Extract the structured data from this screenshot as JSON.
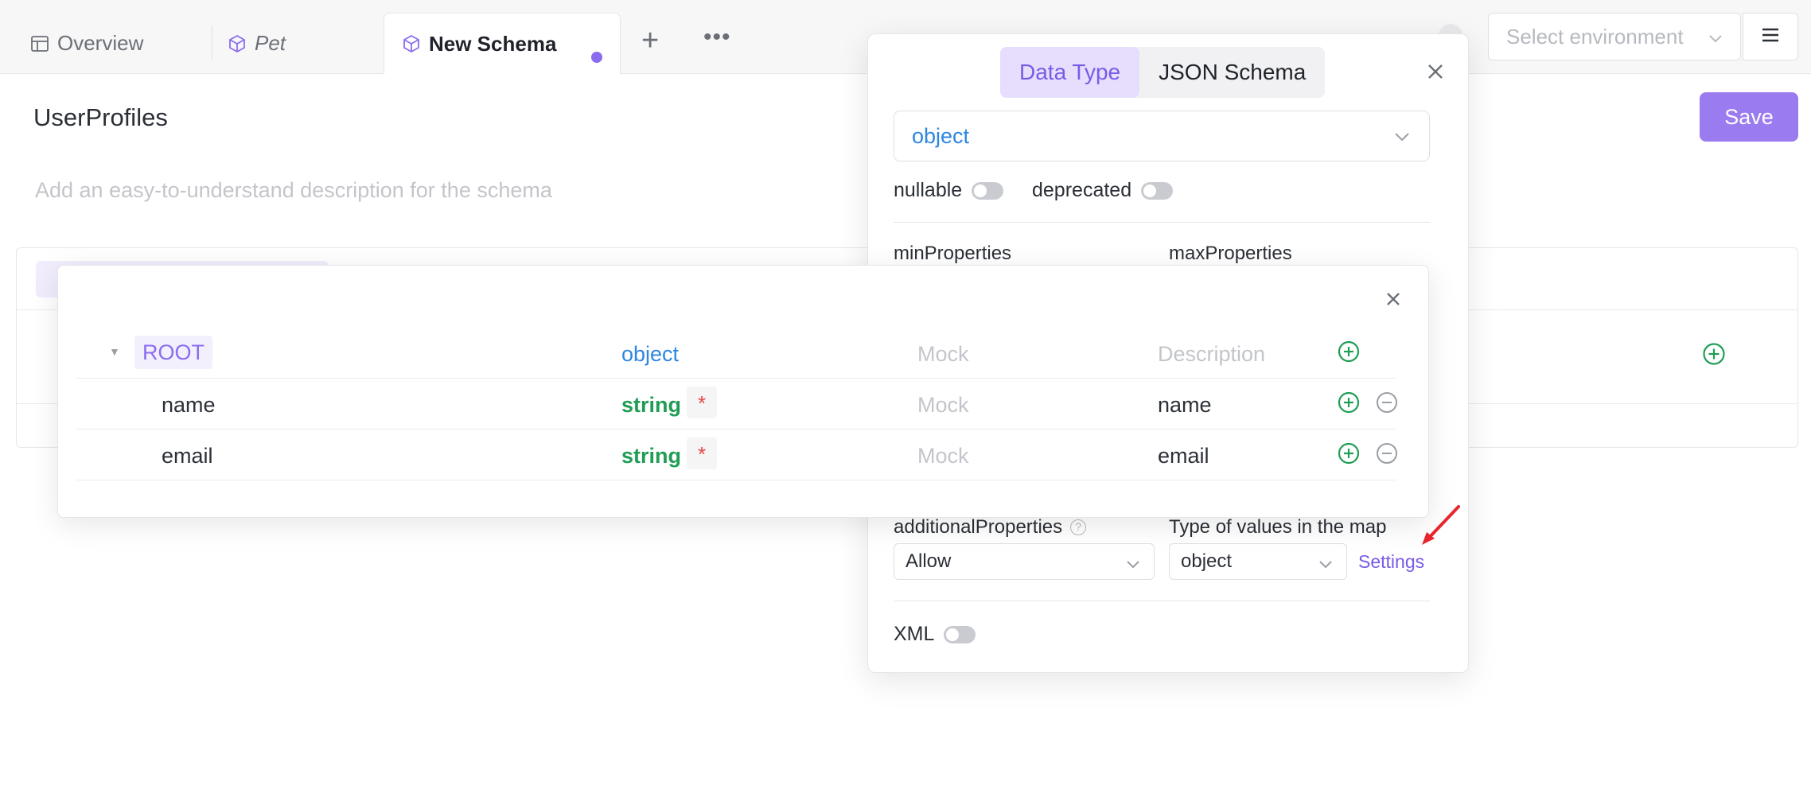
{
  "tabs": [
    {
      "label": "Overview",
      "icon": "table-icon"
    },
    {
      "label": "Pet",
      "icon": "cube-icon"
    },
    {
      "label": "New Schema",
      "icon": "cube-icon",
      "active": true,
      "unsaved": true
    }
  ],
  "header": {
    "environment_placeholder": "Select environment"
  },
  "page": {
    "title": "UserProfiles",
    "description_placeholder": "Add an easy-to-understand description for the schema",
    "save_label": "Save"
  },
  "popover": {
    "tabs": [
      "Data Type",
      "JSON Schema"
    ],
    "active_tab": "Data Type",
    "type_value": "object",
    "nullable_label": "nullable",
    "deprecated_label": "deprecated",
    "min_properties_label": "minProperties",
    "max_properties_label": "maxProperties",
    "additional_properties_label": "additionalProperties",
    "additional_properties_value": "Allow",
    "map_values_label": "Type of values in the map",
    "map_values_value": "object",
    "settings_label": "Settings",
    "xml_label": "XML"
  },
  "properties": {
    "root": {
      "name": "ROOT",
      "type": "object",
      "mock_placeholder": "Mock",
      "description_placeholder": "Description"
    },
    "rows": [
      {
        "name": "name",
        "type": "string",
        "required_mark": "*",
        "mock_placeholder": "Mock",
        "description": "name"
      },
      {
        "name": "email",
        "type": "string",
        "required_mark": "*",
        "mock_placeholder": "Mock",
        "description": "email"
      }
    ]
  },
  "colors": {
    "accent": "#9b7bf0",
    "type_object": "#2f86e0",
    "type_string": "#1f9d55",
    "required": "#e54545",
    "add_icon": "#1f9d55"
  }
}
